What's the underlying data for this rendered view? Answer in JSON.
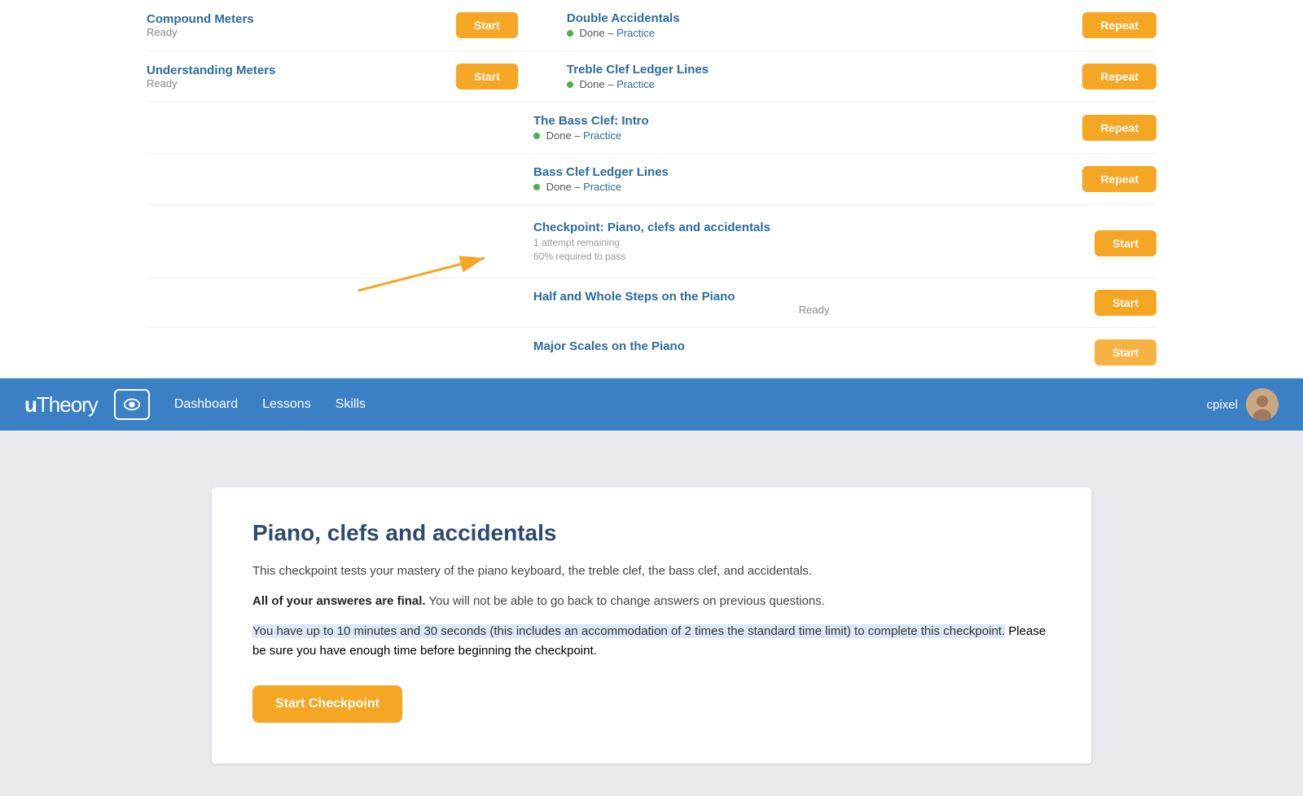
{
  "brand": {
    "name_start": "u",
    "name_end": "Theory"
  },
  "navbar": {
    "links": [
      "Dashboard",
      "Lessons",
      "Skills"
    ],
    "username": "cpixel"
  },
  "lessons": [
    {
      "id": "compound-meters",
      "left_title": "Compound Meters",
      "left_status": "Ready",
      "left_btn": "Start",
      "has_left": true
    },
    {
      "id": "understanding-meters",
      "left_title": "Understanding Meters",
      "left_status": "Ready",
      "left_btn": "Start",
      "has_left": true
    }
  ],
  "right_lessons": [
    {
      "id": "double-accidentals",
      "title": "Double Accidentals",
      "status": "Done",
      "btn": "Repeat",
      "practice": "Practice"
    },
    {
      "id": "treble-clef-ledger",
      "title": "Treble Clef Ledger Lines",
      "status": "Done",
      "btn": "Repeat",
      "practice": "Practice"
    },
    {
      "id": "bass-clef-intro",
      "title": "The Bass Clef: Intro",
      "status": "Done",
      "btn": "Repeat",
      "practice": "Practice"
    },
    {
      "id": "bass-clef-ledger",
      "title": "Bass Clef Ledger Lines",
      "status": "Done",
      "btn": "Repeat",
      "practice": "Practice"
    },
    {
      "id": "checkpoint-piano",
      "title": "Checkpoint: Piano, clefs and accidentals",
      "attempts": "1 attempt remaining",
      "required": "60% required to pass",
      "btn": "Start",
      "is_checkpoint": true
    },
    {
      "id": "half-whole-steps",
      "title": "Half and Whole Steps on the Piano",
      "status": "Ready",
      "btn": "Start",
      "is_ready": true
    },
    {
      "id": "major-scales",
      "title": "Major Scales on the Piano",
      "btn": "Start"
    }
  ],
  "modal": {
    "title": "Piano, clefs and accidentals",
    "desc": "This checkpoint tests your mastery of the piano keyboard, the treble clef, the bass clef, and accidentals.",
    "warning_bold": "All of your answeres are final.",
    "warning_rest": " You will not be able to go back to change answers on previous questions.",
    "highlight": "You have up to 10 minutes and 30 seconds (this includes an accommodation of 2 times the standard time limit) to complete this checkpoint.",
    "note": " Please be sure you have enough time before beginning the checkpoint.",
    "btn_label": "Start Checkpoint"
  },
  "icons": {
    "eye": "eye-icon",
    "user": "user-avatar-icon"
  },
  "colors": {
    "orange": "#f5a623",
    "blue_nav": "#3b7fc4",
    "blue_link": "#2c6b9e",
    "highlight_bg": "#dbe8f7"
  }
}
